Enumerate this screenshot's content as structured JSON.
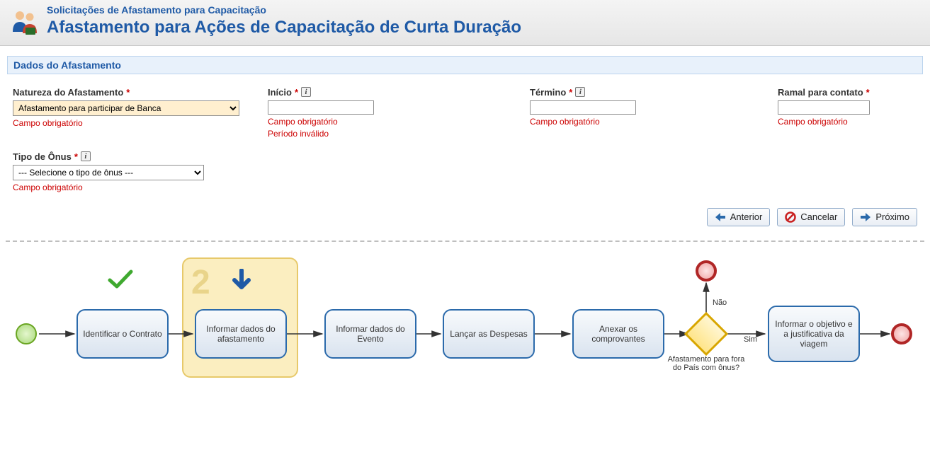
{
  "header": {
    "breadcrumb": "Solicitações de Afastamento para Capacitação",
    "title": "Afastamento para Ações de Capacitação de Curta Duração"
  },
  "section": {
    "dados": "Dados do Afastamento"
  },
  "form": {
    "natureza": {
      "label": "Natureza do Afastamento",
      "value": "Afastamento para participar de Banca",
      "err1": "Campo obrigatório"
    },
    "inicio": {
      "label": "Início",
      "value": "",
      "err1": "Campo obrigatório",
      "err2": "Período inválido"
    },
    "termino": {
      "label": "Término",
      "value": "",
      "err1": "Campo obrigatório"
    },
    "ramal": {
      "label": "Ramal para contato",
      "value": "",
      "err1": "Campo obrigatório"
    },
    "tipoOnus": {
      "label": "Tipo de Ônus",
      "value": "--- Selecione o tipo de ônus ---",
      "err1": "Campo obrigatório"
    }
  },
  "buttons": {
    "anterior": "Anterior",
    "cancelar": "Cancelar",
    "proximo": "Próximo"
  },
  "flow": {
    "steps": {
      "s1": "Identificar o Contrato",
      "s2": "Informar dados do afastamento",
      "s3": "Informar dados do Evento",
      "s4": "Lançar as Despesas",
      "s5": "Anexar os comprovantes",
      "s6": "Informar  o objetivo e a justificativa da viagem"
    },
    "gateway": {
      "question": "Afastamento para fora do País  com ônus?",
      "yes": "Sim",
      "no": "Não"
    },
    "currentStepNumber": "2"
  }
}
